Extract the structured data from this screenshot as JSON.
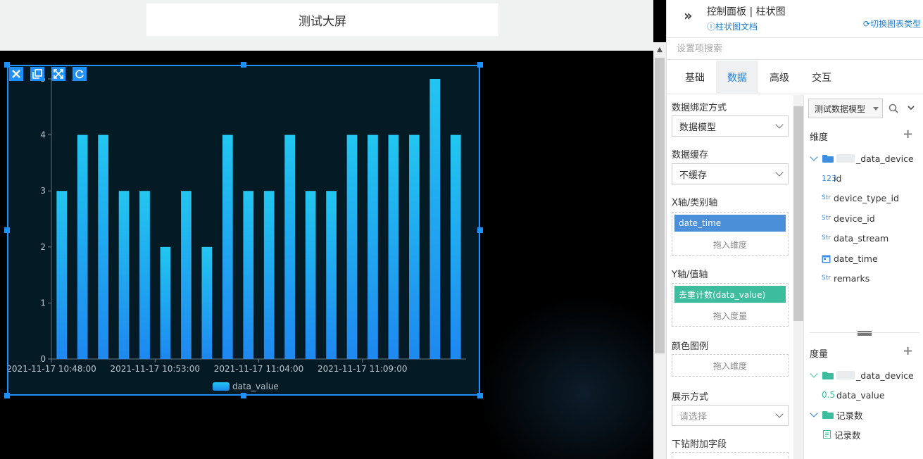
{
  "canvas": {
    "screen_title": "测试大屏"
  },
  "widget_toolbar": {
    "icons": [
      "close-icon",
      "copy-icon",
      "fullscreen-icon",
      "refresh-icon"
    ]
  },
  "chart_data": {
    "type": "bar",
    "categories": [
      "2021-11-17 10:48:00",
      "",
      "",
      "",
      "",
      "2021-11-17 10:53:00",
      "",
      "",
      "",
      "",
      "2021-11-17 11:04:00",
      "",
      "",
      "",
      "",
      "2021-11-17 11:09:00",
      "",
      "",
      "",
      "",
      ""
    ],
    "x_tick_labels": [
      "2021-11-17 10:48:00",
      "2021-11-17 10:53:00",
      "2021-11-17 11:04:00",
      "2021-11-17 11:09:00"
    ],
    "series": [
      {
        "name": "data_value",
        "values": [
          3,
          4,
          4,
          3,
          3,
          2,
          3,
          2,
          4,
          3,
          3,
          4,
          3,
          3,
          4,
          4,
          4,
          4,
          5,
          4
        ]
      }
    ],
    "ylim": [
      0,
      5
    ],
    "yticks": [
      0,
      1,
      2,
      3,
      4,
      5
    ],
    "grid": false,
    "legend": "bottom-center",
    "colors": {
      "bar_top": "#22c6f0",
      "bar_bottom": "#1e88f0",
      "axis": "#6a7c88",
      "tick_text": "#b8c4cc"
    }
  },
  "panel": {
    "title": "控制面板 | 柱状图",
    "doc_link": "柱状图文档",
    "switch_link": "切换图表类型",
    "search_placeholder": "设置项搜索",
    "tabs": [
      {
        "label": "基础",
        "active": false
      },
      {
        "label": "数据",
        "active": true
      },
      {
        "label": "高级",
        "active": false
      },
      {
        "label": "交互",
        "active": false
      }
    ]
  },
  "settings": {
    "binding_label": "数据绑定方式",
    "binding_value": "数据模型",
    "cache_label": "数据缓存",
    "cache_value": "不缓存",
    "x_axis_label": "X轴/类别轴",
    "x_axis_chip": "date_time",
    "x_axis_hint": "拖入维度",
    "y_axis_label": "Y轴/值轴",
    "y_axis_chip": "去重计数(data_value)",
    "y_axis_hint": "拖入度量",
    "color_label": "颜色图例",
    "color_hint": "拖入维度",
    "display_label": "展示方式",
    "display_placeholder": "请选择",
    "drill_label": "下钻附加字段"
  },
  "fields": {
    "model_select": "测试数据模型",
    "dimension_title": "维度",
    "dimension_table": "_data_device",
    "dimension_fields": [
      {
        "type": "123",
        "name": "id"
      },
      {
        "type": "Str",
        "name": "device_type_id"
      },
      {
        "type": "Str",
        "name": "device_id"
      },
      {
        "type": "Str",
        "name": "data_stream"
      },
      {
        "type": "date",
        "name": "date_time"
      },
      {
        "type": "Str",
        "name": "remarks"
      }
    ],
    "measure_title": "度量",
    "measure_table": "_data_device",
    "measure_field_type": "0.5",
    "measure_field": "data_value",
    "record_folder": "记录数",
    "record_field": "记录数"
  }
}
